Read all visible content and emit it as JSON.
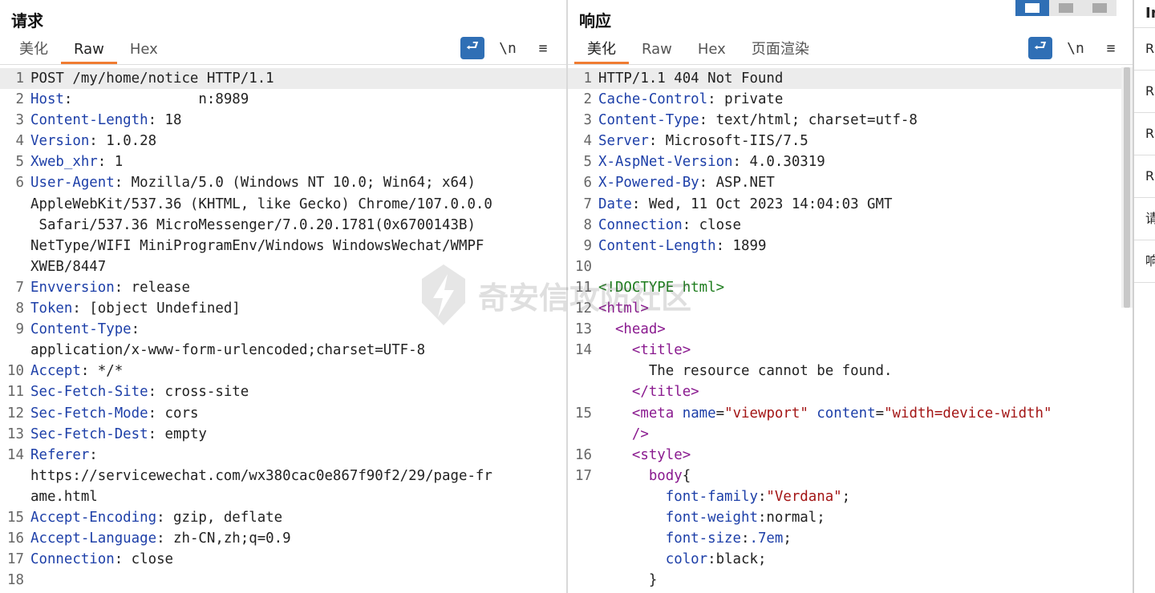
{
  "request": {
    "title": "请求",
    "tabs": [
      "美化",
      "Raw",
      "Hex"
    ],
    "active_tab": "Raw",
    "tools": [
      "wrap-icon",
      "\\n",
      "≡"
    ],
    "lines": [
      {
        "n": "1",
        "key": "",
        "sep": "",
        "val": "POST /my/home/notice HTTP/1.1",
        "hl": true
      },
      {
        "n": "2",
        "key": "Host",
        "sep": ": ",
        "val": "              n:8989"
      },
      {
        "n": "3",
        "key": "Content-Length",
        "sep": ": ",
        "val": "18"
      },
      {
        "n": "4",
        "key": "Version",
        "sep": ": ",
        "val": "1.0.28"
      },
      {
        "n": "5",
        "key": "Xweb_xhr",
        "sep": ": ",
        "val": "1"
      },
      {
        "n": "6",
        "key": "User-Agent",
        "sep": ": ",
        "val": "Mozilla/5.0 (Windows NT 10.0; Win64; x64)"
      },
      {
        "n": "",
        "key": "",
        "sep": "",
        "val": "AppleWebKit/537.36 (KHTML, like Gecko) Chrome/107.0.0.0"
      },
      {
        "n": "",
        "key": "",
        "sep": "",
        "val": " Safari/537.36 MicroMessenger/7.0.20.1781(0x6700143B)"
      },
      {
        "n": "",
        "key": "",
        "sep": "",
        "val": "NetType/WIFI MiniProgramEnv/Windows WindowsWechat/WMPF"
      },
      {
        "n": "",
        "key": "",
        "sep": "",
        "val": "XWEB/8447"
      },
      {
        "n": "7",
        "key": "Envversion",
        "sep": ": ",
        "val": "release"
      },
      {
        "n": "8",
        "key": "Token",
        "sep": ": ",
        "val": "[object Undefined]"
      },
      {
        "n": "9",
        "key": "Content-Type",
        "sep": ":",
        "val": ""
      },
      {
        "n": "",
        "key": "",
        "sep": "",
        "val": "application/x-www-form-urlencoded;charset=UTF-8"
      },
      {
        "n": "10",
        "key": "Accept",
        "sep": ": ",
        "val": "*/*"
      },
      {
        "n": "11",
        "key": "Sec-Fetch-Site",
        "sep": ": ",
        "val": "cross-site"
      },
      {
        "n": "12",
        "key": "Sec-Fetch-Mode",
        "sep": ": ",
        "val": "cors"
      },
      {
        "n": "13",
        "key": "Sec-Fetch-Dest",
        "sep": ": ",
        "val": "empty"
      },
      {
        "n": "14",
        "key": "Referer",
        "sep": ":",
        "val": ""
      },
      {
        "n": "",
        "key": "",
        "sep": "",
        "val": "https://servicewechat.com/wx380cac0e867f90f2/29/page-fr"
      },
      {
        "n": "",
        "key": "",
        "sep": "",
        "val": "ame.html"
      },
      {
        "n": "15",
        "key": "Accept-Encoding",
        "sep": ": ",
        "val": "gzip, deflate"
      },
      {
        "n": "16",
        "key": "Accept-Language",
        "sep": ": ",
        "val": "zh-CN,zh;q=0.9"
      },
      {
        "n": "17",
        "key": "Connection",
        "sep": ": ",
        "val": "close"
      },
      {
        "n": "18",
        "key": "",
        "sep": "",
        "val": ""
      }
    ]
  },
  "response": {
    "title": "响应",
    "tabs": [
      "美化",
      "Raw",
      "Hex",
      "页面渲染"
    ],
    "active_tab": "美化",
    "tools": [
      "wrap-icon",
      "\\n",
      "≡"
    ],
    "lines": [
      {
        "n": "1",
        "segs": [
          [
            "v",
            "HTTP/1.1 404 Not Found"
          ]
        ],
        "hl": true
      },
      {
        "n": "2",
        "segs": [
          [
            "k",
            "Cache-Control"
          ],
          [
            "v",
            ": private"
          ]
        ]
      },
      {
        "n": "3",
        "segs": [
          [
            "k",
            "Content-Type"
          ],
          [
            "v",
            ": text/html; charset=utf-8"
          ]
        ]
      },
      {
        "n": "4",
        "segs": [
          [
            "k",
            "Server"
          ],
          [
            "v",
            ": Microsoft-IIS/7.5"
          ]
        ]
      },
      {
        "n": "5",
        "segs": [
          [
            "k",
            "X-AspNet-Version"
          ],
          [
            "v",
            ": 4.0.30319"
          ]
        ]
      },
      {
        "n": "6",
        "segs": [
          [
            "k",
            "X-Powered-By"
          ],
          [
            "v",
            ": ASP.NET"
          ]
        ]
      },
      {
        "n": "7",
        "segs": [
          [
            "k",
            "Date"
          ],
          [
            "v",
            ": Wed, 11 Oct 2023 14:04:03 GMT"
          ]
        ]
      },
      {
        "n": "8",
        "segs": [
          [
            "k",
            "Connection"
          ],
          [
            "v",
            ": close"
          ]
        ]
      },
      {
        "n": "9",
        "segs": [
          [
            "k",
            "Content-Length"
          ],
          [
            "v",
            ": 1899"
          ]
        ]
      },
      {
        "n": "10",
        "segs": []
      },
      {
        "n": "11",
        "segs": [
          [
            "cm",
            "<!DOCTYPE html>"
          ]
        ]
      },
      {
        "n": "12",
        "segs": [
          [
            "tg",
            "<html>"
          ]
        ]
      },
      {
        "n": "13",
        "segs": [
          [
            "v",
            "  "
          ],
          [
            "tg",
            "<head>"
          ]
        ]
      },
      {
        "n": "14",
        "segs": [
          [
            "v",
            "    "
          ],
          [
            "tg",
            "<title>"
          ]
        ]
      },
      {
        "n": "",
        "segs": [
          [
            "v",
            "      The resource cannot be found."
          ]
        ]
      },
      {
        "n": "",
        "segs": [
          [
            "v",
            "    "
          ],
          [
            "tg",
            "</title>"
          ]
        ]
      },
      {
        "n": "15",
        "segs": [
          [
            "v",
            "    "
          ],
          [
            "tg",
            "<meta "
          ],
          [
            "at",
            "name"
          ],
          [
            "v",
            "="
          ],
          [
            "sv",
            "\"viewport\""
          ],
          [
            "v",
            " "
          ],
          [
            "at",
            "content"
          ],
          [
            "v",
            "="
          ],
          [
            "sv",
            "\"width=device-width\""
          ]
        ]
      },
      {
        "n": "",
        "segs": [
          [
            "v",
            "    "
          ],
          [
            "tg",
            "/>"
          ]
        ]
      },
      {
        "n": "16",
        "segs": [
          [
            "v",
            "    "
          ],
          [
            "tg",
            "<style>"
          ]
        ]
      },
      {
        "n": "17",
        "segs": [
          [
            "v",
            "      "
          ],
          [
            "tg",
            "body"
          ],
          [
            "v",
            "{"
          ]
        ]
      },
      {
        "n": "",
        "segs": [
          [
            "v",
            "        "
          ],
          [
            "at",
            "font-family"
          ],
          [
            "v",
            ":"
          ],
          [
            "sv",
            "\"Verdana\""
          ],
          [
            "v",
            ";"
          ]
        ]
      },
      {
        "n": "",
        "segs": [
          [
            "v",
            "        "
          ],
          [
            "at",
            "font-weight"
          ],
          [
            "v",
            ":normal;"
          ]
        ]
      },
      {
        "n": "",
        "segs": [
          [
            "v",
            "        "
          ],
          [
            "at",
            "font-size"
          ],
          [
            "v",
            ":"
          ],
          [
            "at",
            ".7em"
          ],
          [
            "v",
            ";"
          ]
        ]
      },
      {
        "n": "",
        "segs": [
          [
            "v",
            "        "
          ],
          [
            "at",
            "color"
          ],
          [
            "v",
            ":black;"
          ]
        ]
      },
      {
        "n": "",
        "segs": [
          [
            "v",
            "      }"
          ]
        ]
      }
    ]
  },
  "sidebar": {
    "header": "In",
    "items": [
      "R",
      "R",
      "R",
      "R",
      "请",
      "响"
    ]
  },
  "watermark": "奇安信攻防社区",
  "colors": {
    "accent": "#f07c32",
    "blue": "#2f6fb5"
  }
}
